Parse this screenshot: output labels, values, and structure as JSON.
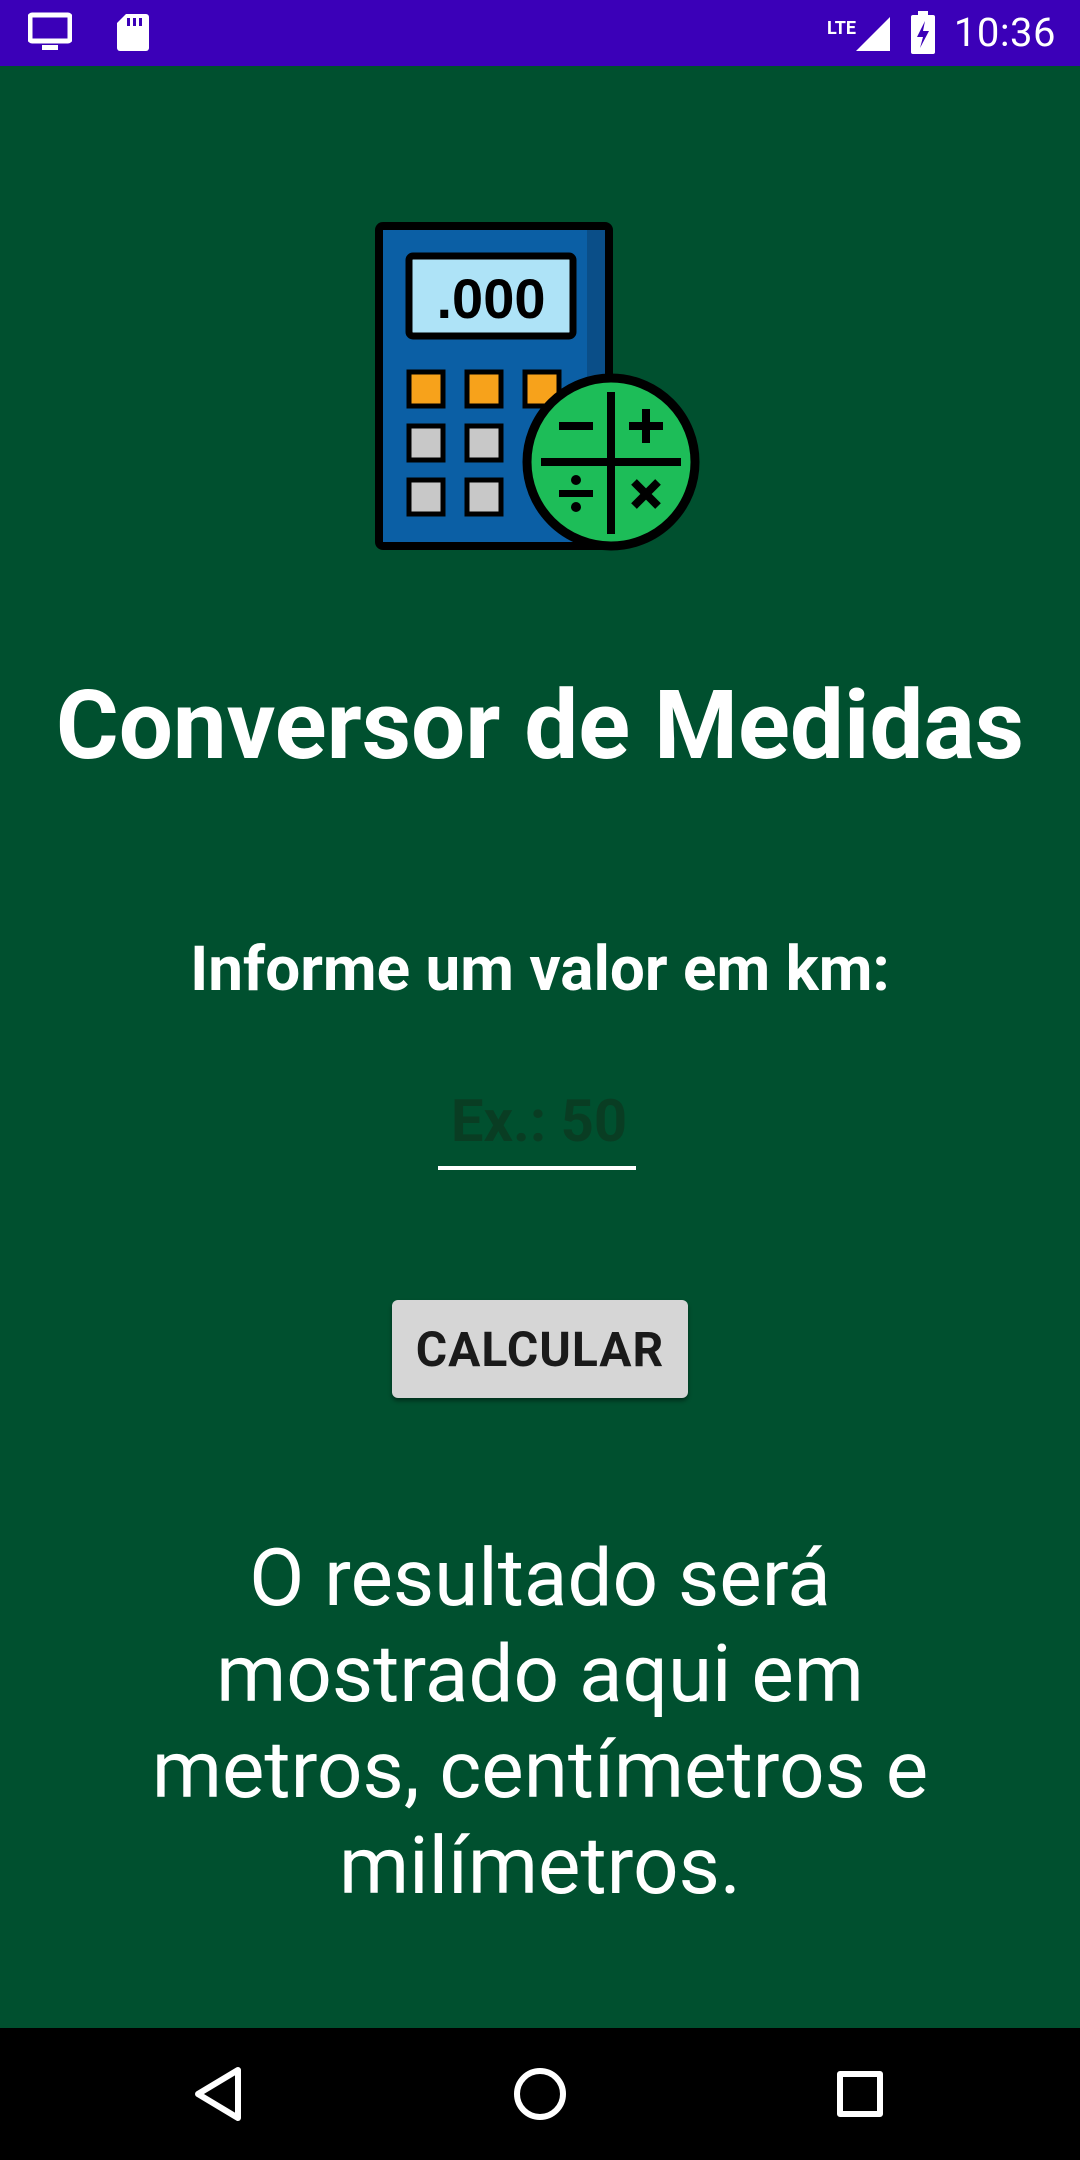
{
  "status_bar": {
    "time": "10:36",
    "network": "LTE",
    "icons": [
      "monitor-icon",
      "sd-card-icon",
      "signal-icon",
      "battery-charging-icon"
    ]
  },
  "app": {
    "title": "Conversor de Medidas",
    "prompt": "Informe um valor em km:",
    "input": {
      "value": "",
      "placeholder": "Ex.: 50"
    },
    "button_label": "CALCULAR",
    "result_text": "O resultado será mostrado aqui em metros, centímetros e milímetros."
  },
  "logo": {
    "display": ".000"
  },
  "nav_bar": {
    "icons": [
      "back-icon",
      "home-icon",
      "recents-icon"
    ]
  },
  "colors": {
    "background": "#00502F",
    "status_bar": "#3B00B8",
    "button": "#D6D6D6"
  }
}
